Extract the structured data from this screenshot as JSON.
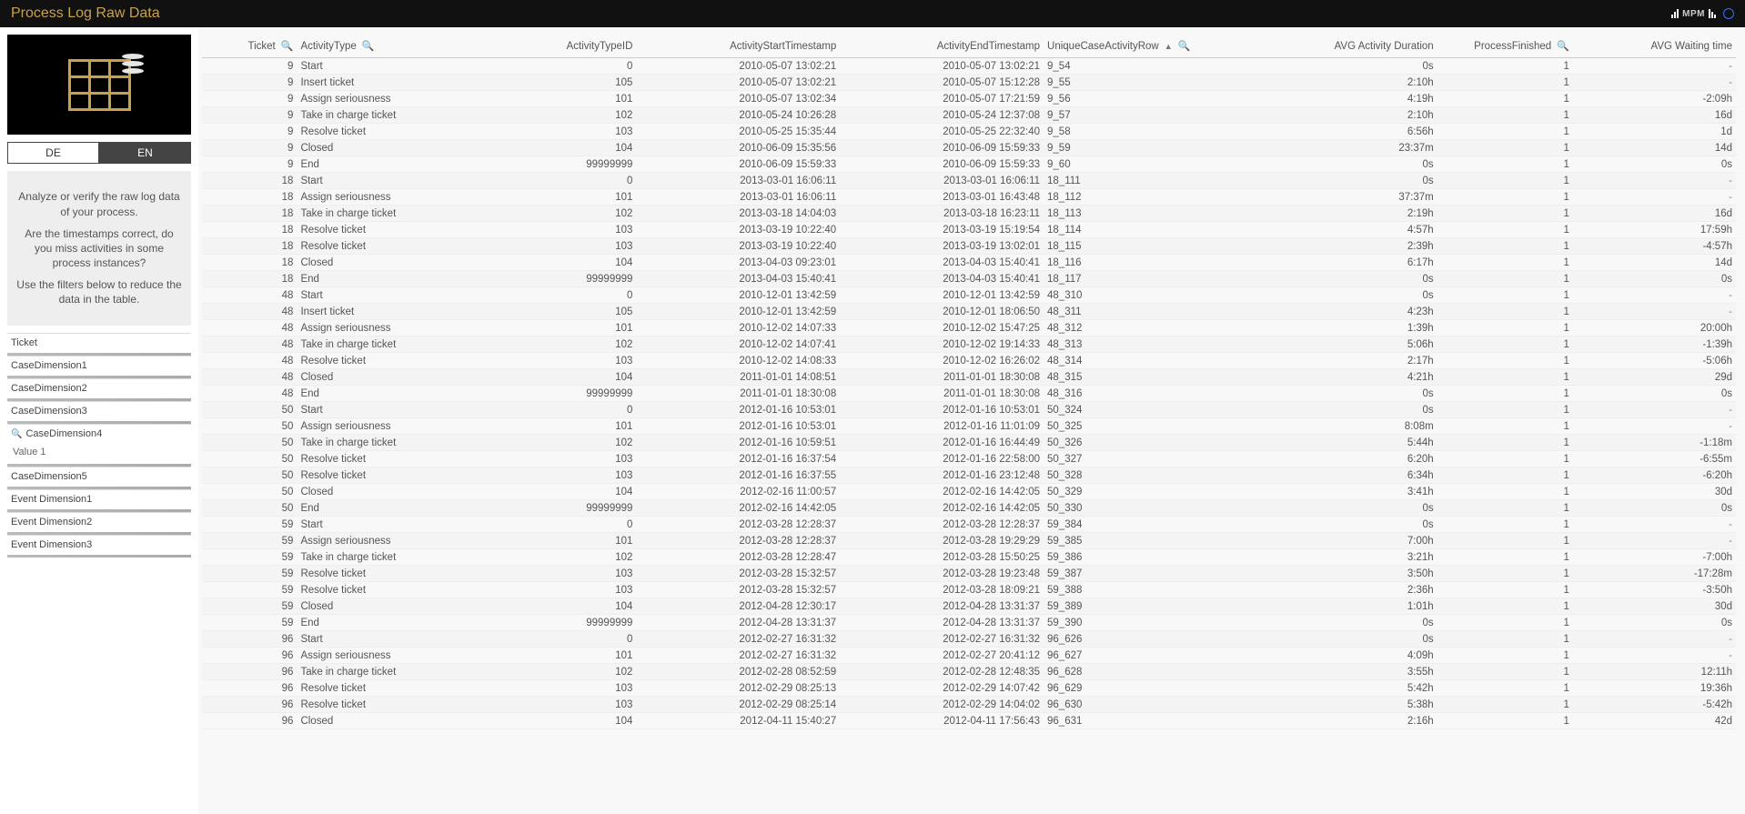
{
  "header": {
    "title": "Process Log Raw Data",
    "logo_text": "MPM"
  },
  "sidebar": {
    "lang": {
      "de": "DE",
      "en": "EN"
    },
    "info": {
      "p1": "Analyze or verify the raw log data of your process.",
      "p2": "Are the timestamps correct, do you miss activities in some process instances?",
      "p3": "Use the filters below to reduce the data in the table."
    },
    "filters": [
      {
        "name": "Ticket"
      },
      {
        "name": "CaseDimension1"
      },
      {
        "name": "CaseDimension2"
      },
      {
        "name": "CaseDimension3"
      },
      {
        "name": "CaseDimension4",
        "search": true,
        "value": "Value 1"
      },
      {
        "name": "CaseDimension5"
      },
      {
        "name": "Event Dimension1"
      },
      {
        "name": "Event Dimension2"
      },
      {
        "name": "Event Dimension3"
      }
    ]
  },
  "table": {
    "columns": [
      {
        "key": "ticket",
        "label": "Ticket",
        "align": "right",
        "search": true
      },
      {
        "key": "activityType",
        "label": "ActivityType",
        "align": "left",
        "search": true
      },
      {
        "key": "activityTypeId",
        "label": "ActivityTypeID",
        "align": "right"
      },
      {
        "key": "start",
        "label": "ActivityStartTimestamp",
        "align": "right"
      },
      {
        "key": "end",
        "label": "ActivityEndTimestamp",
        "align": "right"
      },
      {
        "key": "ucar",
        "label": "UniqueCaseActivityRow",
        "align": "left",
        "search": true,
        "sort": true
      },
      {
        "key": "dur",
        "label": "AVG Activity Duration",
        "align": "right"
      },
      {
        "key": "fin",
        "label": "ProcessFinished",
        "align": "right",
        "search": true
      },
      {
        "key": "wait",
        "label": "AVG Waiting time",
        "align": "right"
      }
    ],
    "rows": [
      {
        "ticket": 9,
        "activityType": "Start",
        "activityTypeId": 0,
        "start": "2010-05-07 13:02:21",
        "end": "2010-05-07 13:02:21",
        "ucar": "9_54",
        "dur": "0s",
        "fin": 1,
        "wait": "-"
      },
      {
        "ticket": 9,
        "activityType": "Insert ticket",
        "activityTypeId": 105,
        "start": "2010-05-07 13:02:21",
        "end": "2010-05-07 15:12:28",
        "ucar": "9_55",
        "dur": "2:10h",
        "fin": 1,
        "wait": "-"
      },
      {
        "ticket": 9,
        "activityType": "Assign seriousness",
        "activityTypeId": 101,
        "start": "2010-05-07 13:02:34",
        "end": "2010-05-07 17:21:59",
        "ucar": "9_56",
        "dur": "4:19h",
        "fin": 1,
        "wait": "-2:09h"
      },
      {
        "ticket": 9,
        "activityType": "Take in charge ticket",
        "activityTypeId": 102,
        "start": "2010-05-24 10:26:28",
        "end": "2010-05-24 12:37:08",
        "ucar": "9_57",
        "dur": "2:10h",
        "fin": 1,
        "wait": "16d"
      },
      {
        "ticket": 9,
        "activityType": "Resolve ticket",
        "activityTypeId": 103,
        "start": "2010-05-25 15:35:44",
        "end": "2010-05-25 22:32:40",
        "ucar": "9_58",
        "dur": "6:56h",
        "fin": 1,
        "wait": "1d"
      },
      {
        "ticket": 9,
        "activityType": "Closed",
        "activityTypeId": 104,
        "start": "2010-06-09 15:35:56",
        "end": "2010-06-09 15:59:33",
        "ucar": "9_59",
        "dur": "23:37m",
        "fin": 1,
        "wait": "14d"
      },
      {
        "ticket": 9,
        "activityType": "End",
        "activityTypeId": 99999999,
        "start": "2010-06-09 15:59:33",
        "end": "2010-06-09 15:59:33",
        "ucar": "9_60",
        "dur": "0s",
        "fin": 1,
        "wait": "0s"
      },
      {
        "ticket": 18,
        "activityType": "Start",
        "activityTypeId": 0,
        "start": "2013-03-01 16:06:11",
        "end": "2013-03-01 16:06:11",
        "ucar": "18_111",
        "dur": "0s",
        "fin": 1,
        "wait": "-"
      },
      {
        "ticket": 18,
        "activityType": "Assign seriousness",
        "activityTypeId": 101,
        "start": "2013-03-01 16:06:11",
        "end": "2013-03-01 16:43:48",
        "ucar": "18_112",
        "dur": "37:37m",
        "fin": 1,
        "wait": "-"
      },
      {
        "ticket": 18,
        "activityType": "Take in charge ticket",
        "activityTypeId": 102,
        "start": "2013-03-18 14:04:03",
        "end": "2013-03-18 16:23:11",
        "ucar": "18_113",
        "dur": "2:19h",
        "fin": 1,
        "wait": "16d"
      },
      {
        "ticket": 18,
        "activityType": "Resolve ticket",
        "activityTypeId": 103,
        "start": "2013-03-19 10:22:40",
        "end": "2013-03-19 15:19:54",
        "ucar": "18_114",
        "dur": "4:57h",
        "fin": 1,
        "wait": "17:59h"
      },
      {
        "ticket": 18,
        "activityType": "Resolve ticket",
        "activityTypeId": 103,
        "start": "2013-03-19 10:22:40",
        "end": "2013-03-19 13:02:01",
        "ucar": "18_115",
        "dur": "2:39h",
        "fin": 1,
        "wait": "-4:57h"
      },
      {
        "ticket": 18,
        "activityType": "Closed",
        "activityTypeId": 104,
        "start": "2013-04-03 09:23:01",
        "end": "2013-04-03 15:40:41",
        "ucar": "18_116",
        "dur": "6:17h",
        "fin": 1,
        "wait": "14d"
      },
      {
        "ticket": 18,
        "activityType": "End",
        "activityTypeId": 99999999,
        "start": "2013-04-03 15:40:41",
        "end": "2013-04-03 15:40:41",
        "ucar": "18_117",
        "dur": "0s",
        "fin": 1,
        "wait": "0s"
      },
      {
        "ticket": 48,
        "activityType": "Start",
        "activityTypeId": 0,
        "start": "2010-12-01 13:42:59",
        "end": "2010-12-01 13:42:59",
        "ucar": "48_310",
        "dur": "0s",
        "fin": 1,
        "wait": "-"
      },
      {
        "ticket": 48,
        "activityType": "Insert ticket",
        "activityTypeId": 105,
        "start": "2010-12-01 13:42:59",
        "end": "2010-12-01 18:06:50",
        "ucar": "48_311",
        "dur": "4:23h",
        "fin": 1,
        "wait": "-"
      },
      {
        "ticket": 48,
        "activityType": "Assign seriousness",
        "activityTypeId": 101,
        "start": "2010-12-02 14:07:33",
        "end": "2010-12-02 15:47:25",
        "ucar": "48_312",
        "dur": "1:39h",
        "fin": 1,
        "wait": "20:00h"
      },
      {
        "ticket": 48,
        "activityType": "Take in charge ticket",
        "activityTypeId": 102,
        "start": "2010-12-02 14:07:41",
        "end": "2010-12-02 19:14:33",
        "ucar": "48_313",
        "dur": "5:06h",
        "fin": 1,
        "wait": "-1:39h"
      },
      {
        "ticket": 48,
        "activityType": "Resolve ticket",
        "activityTypeId": 103,
        "start": "2010-12-02 14:08:33",
        "end": "2010-12-02 16:26:02",
        "ucar": "48_314",
        "dur": "2:17h",
        "fin": 1,
        "wait": "-5:06h"
      },
      {
        "ticket": 48,
        "activityType": "Closed",
        "activityTypeId": 104,
        "start": "2011-01-01 14:08:51",
        "end": "2011-01-01 18:30:08",
        "ucar": "48_315",
        "dur": "4:21h",
        "fin": 1,
        "wait": "29d"
      },
      {
        "ticket": 48,
        "activityType": "End",
        "activityTypeId": 99999999,
        "start": "2011-01-01 18:30:08",
        "end": "2011-01-01 18:30:08",
        "ucar": "48_316",
        "dur": "0s",
        "fin": 1,
        "wait": "0s"
      },
      {
        "ticket": 50,
        "activityType": "Start",
        "activityTypeId": 0,
        "start": "2012-01-16 10:53:01",
        "end": "2012-01-16 10:53:01",
        "ucar": "50_324",
        "dur": "0s",
        "fin": 1,
        "wait": "-"
      },
      {
        "ticket": 50,
        "activityType": "Assign seriousness",
        "activityTypeId": 101,
        "start": "2012-01-16 10:53:01",
        "end": "2012-01-16 11:01:09",
        "ucar": "50_325",
        "dur": "8:08m",
        "fin": 1,
        "wait": "-"
      },
      {
        "ticket": 50,
        "activityType": "Take in charge ticket",
        "activityTypeId": 102,
        "start": "2012-01-16 10:59:51",
        "end": "2012-01-16 16:44:49",
        "ucar": "50_326",
        "dur": "5:44h",
        "fin": 1,
        "wait": "-1:18m"
      },
      {
        "ticket": 50,
        "activityType": "Resolve ticket",
        "activityTypeId": 103,
        "start": "2012-01-16 16:37:54",
        "end": "2012-01-16 22:58:00",
        "ucar": "50_327",
        "dur": "6:20h",
        "fin": 1,
        "wait": "-6:55m"
      },
      {
        "ticket": 50,
        "activityType": "Resolve ticket",
        "activityTypeId": 103,
        "start": "2012-01-16 16:37:55",
        "end": "2012-01-16 23:12:48",
        "ucar": "50_328",
        "dur": "6:34h",
        "fin": 1,
        "wait": "-6:20h"
      },
      {
        "ticket": 50,
        "activityType": "Closed",
        "activityTypeId": 104,
        "start": "2012-02-16 11:00:57",
        "end": "2012-02-16 14:42:05",
        "ucar": "50_329",
        "dur": "3:41h",
        "fin": 1,
        "wait": "30d"
      },
      {
        "ticket": 50,
        "activityType": "End",
        "activityTypeId": 99999999,
        "start": "2012-02-16 14:42:05",
        "end": "2012-02-16 14:42:05",
        "ucar": "50_330",
        "dur": "0s",
        "fin": 1,
        "wait": "0s"
      },
      {
        "ticket": 59,
        "activityType": "Start",
        "activityTypeId": 0,
        "start": "2012-03-28 12:28:37",
        "end": "2012-03-28 12:28:37",
        "ucar": "59_384",
        "dur": "0s",
        "fin": 1,
        "wait": "-"
      },
      {
        "ticket": 59,
        "activityType": "Assign seriousness",
        "activityTypeId": 101,
        "start": "2012-03-28 12:28:37",
        "end": "2012-03-28 19:29:29",
        "ucar": "59_385",
        "dur": "7:00h",
        "fin": 1,
        "wait": "-"
      },
      {
        "ticket": 59,
        "activityType": "Take in charge ticket",
        "activityTypeId": 102,
        "start": "2012-03-28 12:28:47",
        "end": "2012-03-28 15:50:25",
        "ucar": "59_386",
        "dur": "3:21h",
        "fin": 1,
        "wait": "-7:00h"
      },
      {
        "ticket": 59,
        "activityType": "Resolve ticket",
        "activityTypeId": 103,
        "start": "2012-03-28 15:32:57",
        "end": "2012-03-28 19:23:48",
        "ucar": "59_387",
        "dur": "3:50h",
        "fin": 1,
        "wait": "-17:28m"
      },
      {
        "ticket": 59,
        "activityType": "Resolve ticket",
        "activityTypeId": 103,
        "start": "2012-03-28 15:32:57",
        "end": "2012-03-28 18:09:21",
        "ucar": "59_388",
        "dur": "2:36h",
        "fin": 1,
        "wait": "-3:50h"
      },
      {
        "ticket": 59,
        "activityType": "Closed",
        "activityTypeId": 104,
        "start": "2012-04-28 12:30:17",
        "end": "2012-04-28 13:31:37",
        "ucar": "59_389",
        "dur": "1:01h",
        "fin": 1,
        "wait": "30d"
      },
      {
        "ticket": 59,
        "activityType": "End",
        "activityTypeId": 99999999,
        "start": "2012-04-28 13:31:37",
        "end": "2012-04-28 13:31:37",
        "ucar": "59_390",
        "dur": "0s",
        "fin": 1,
        "wait": "0s"
      },
      {
        "ticket": 96,
        "activityType": "Start",
        "activityTypeId": 0,
        "start": "2012-02-27 16:31:32",
        "end": "2012-02-27 16:31:32",
        "ucar": "96_626",
        "dur": "0s",
        "fin": 1,
        "wait": "-"
      },
      {
        "ticket": 96,
        "activityType": "Assign seriousness",
        "activityTypeId": 101,
        "start": "2012-02-27 16:31:32",
        "end": "2012-02-27 20:41:12",
        "ucar": "96_627",
        "dur": "4:09h",
        "fin": 1,
        "wait": "-"
      },
      {
        "ticket": 96,
        "activityType": "Take in charge ticket",
        "activityTypeId": 102,
        "start": "2012-02-28 08:52:59",
        "end": "2012-02-28 12:48:35",
        "ucar": "96_628",
        "dur": "3:55h",
        "fin": 1,
        "wait": "12:11h"
      },
      {
        "ticket": 96,
        "activityType": "Resolve ticket",
        "activityTypeId": 103,
        "start": "2012-02-29 08:25:13",
        "end": "2012-02-29 14:07:42",
        "ucar": "96_629",
        "dur": "5:42h",
        "fin": 1,
        "wait": "19:36h"
      },
      {
        "ticket": 96,
        "activityType": "Resolve ticket",
        "activityTypeId": 103,
        "start": "2012-02-29 08:25:14",
        "end": "2012-02-29 14:04:02",
        "ucar": "96_630",
        "dur": "5:38h",
        "fin": 1,
        "wait": "-5:42h"
      },
      {
        "ticket": 96,
        "activityType": "Closed",
        "activityTypeId": 104,
        "start": "2012-04-11 15:40:27",
        "end": "2012-04-11 17:56:43",
        "ucar": "96_631",
        "dur": "2:16h",
        "fin": 1,
        "wait": "42d"
      }
    ]
  }
}
